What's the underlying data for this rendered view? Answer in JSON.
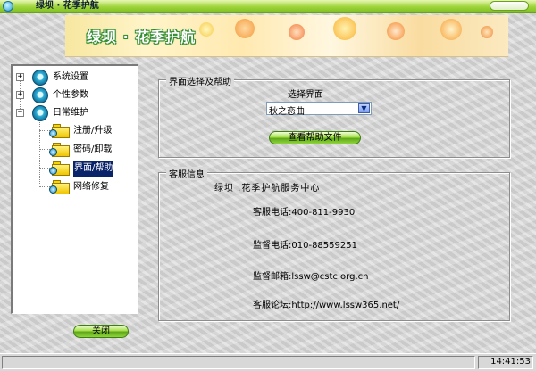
{
  "window": {
    "title": "绿坝 · 花季护航"
  },
  "banner": {
    "text": "绿坝 · 花季护航"
  },
  "tree": {
    "items": [
      {
        "label": "系统设置",
        "expander": "+"
      },
      {
        "label": "个性参数",
        "expander": "+"
      },
      {
        "label": "日常维护",
        "expander": "−"
      },
      {
        "label": "注册/升级"
      },
      {
        "label": "密码/卸载"
      },
      {
        "label": "界面/帮助"
      },
      {
        "label": "网络修复"
      }
    ],
    "selected": "界面/帮助"
  },
  "close_button": {
    "label": "关闭"
  },
  "ui_group": {
    "title": "界面选择及帮助",
    "select_label": "选择界面",
    "select_value": "秋之恋曲",
    "help_button": "查看帮助文件"
  },
  "service_group": {
    "title": "客服信息",
    "center_name": "绿坝 .花季护航服务中心",
    "phone": "客服电话:400-811-9930",
    "supervision_phone": "监督电话:010-88559251",
    "supervision_email": "监督邮箱:lssw@cstc.org.cn",
    "forum": "客服论坛:http://www.lssw365.net/"
  },
  "status": {
    "time": "14:41:53"
  },
  "icons": {
    "app": "app-icon",
    "expand": "plus-box-icon",
    "collapse": "minus-box-icon",
    "settings": "gear-icon",
    "folder": "folder-icon",
    "dropdown": "chevron-down-icon"
  }
}
